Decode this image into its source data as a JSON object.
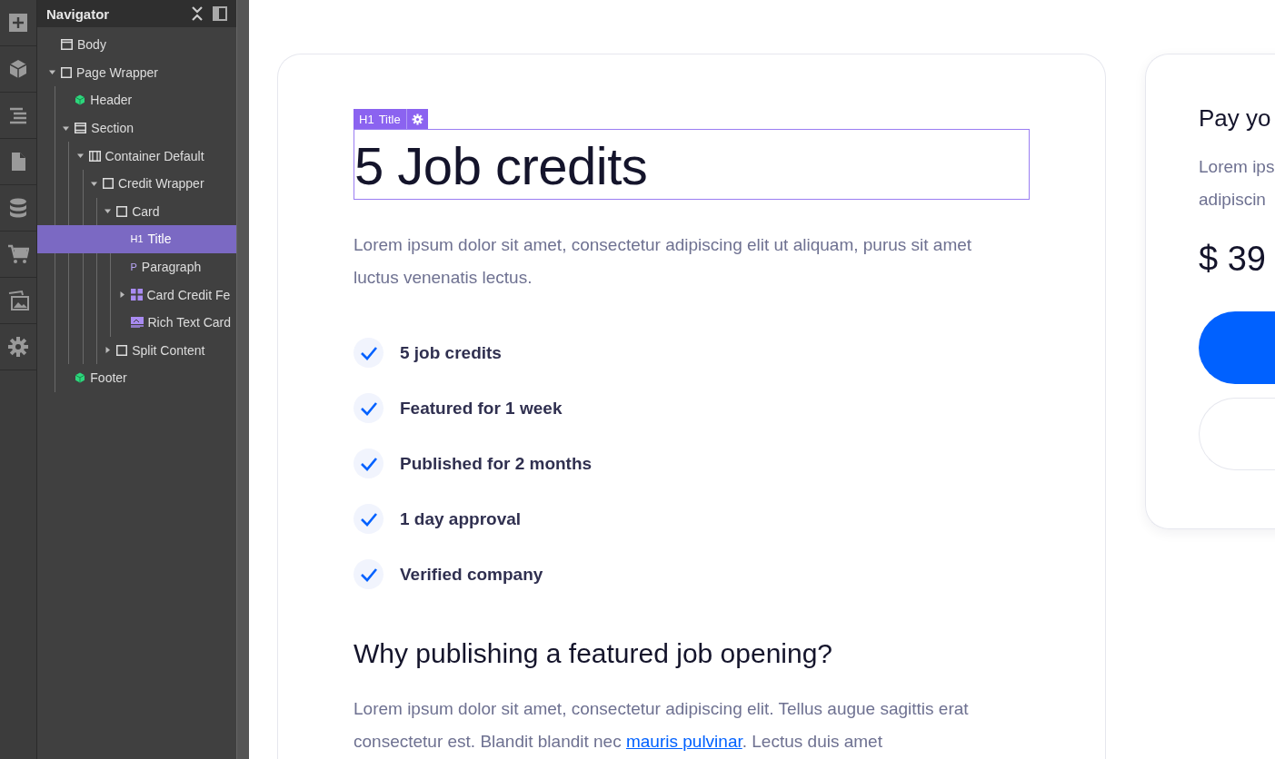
{
  "toolbar": [
    {
      "kind": "add"
    },
    {
      "kind": "cube"
    },
    {
      "kind": "navigator"
    },
    {
      "kind": "page"
    },
    {
      "kind": "database"
    },
    {
      "kind": "cart"
    },
    {
      "kind": "images"
    },
    {
      "kind": "settings"
    }
  ],
  "navigator": {
    "title": "Navigator",
    "tree": [
      {
        "label": "Body",
        "kind": "body",
        "selected": false
      },
      {
        "label": "Page Wrapper",
        "kind": "box",
        "selected": false,
        "expanded": true,
        "children": [
          {
            "label": "Header",
            "kind": "component",
            "selected": false
          },
          {
            "label": "Section",
            "kind": "section",
            "selected": false,
            "expanded": true,
            "children": [
              {
                "label": "Container Default",
                "kind": "container",
                "selected": false,
                "expanded": true,
                "children": [
                  {
                    "label": "Credit Wrapper",
                    "kind": "box",
                    "selected": false,
                    "expanded": true,
                    "children": [
                      {
                        "label": "Card",
                        "kind": "box",
                        "selected": false,
                        "expanded": true,
                        "children": [
                          {
                            "label": "Title",
                            "kind": "heading",
                            "tag": "H1",
                            "selected": true
                          },
                          {
                            "label": "Paragraph",
                            "kind": "paragraph",
                            "tag": "P",
                            "selected": false
                          },
                          {
                            "label": "Card Credit Fe",
                            "kind": "grid",
                            "selected": false,
                            "expanded": false
                          },
                          {
                            "label": "Rich Text Card",
                            "kind": "richtext",
                            "selected": false
                          }
                        ]
                      },
                      {
                        "label": "Split Content",
                        "kind": "box",
                        "selected": false,
                        "expanded": false
                      }
                    ]
                  }
                ]
              }
            ]
          },
          {
            "label": "Footer",
            "kind": "component",
            "selected": false
          }
        ]
      }
    ]
  },
  "card": {
    "element_badge": {
      "tag": "H1",
      "label": "Title"
    },
    "title": "5 Job credits",
    "description": "Lorem ipsum dolor sit amet, consectetur adipiscing elit ut aliquam, purus sit amet luctus venenatis lectus.",
    "features": [
      {
        "label": "5 job credits",
        "checked": true
      },
      {
        "label": "Featured for 1 week",
        "checked": true
      },
      {
        "label": "Published for 2 months",
        "checked": true
      },
      {
        "label": "1 day approval",
        "checked": true
      },
      {
        "label": "Verified company",
        "checked": true
      }
    ],
    "subtitle": "Why publishing a featured job opening?",
    "body": "Lorem ipsum dolor sit amet, consectetur adipiscing elit. Tellus augue sagittis erat consectetur est. Blandit blandit nec ",
    "body_link": "mauris pulvinar",
    "body_end": ". Lectus duis amet"
  },
  "side_card": {
    "title": "Pay yo",
    "text_lines": [
      "Lorem ips",
      "adipiscin"
    ],
    "price": "$ 39",
    "buttons": [
      {
        "kind": "primary"
      },
      {
        "kind": "secondary"
      }
    ]
  }
}
